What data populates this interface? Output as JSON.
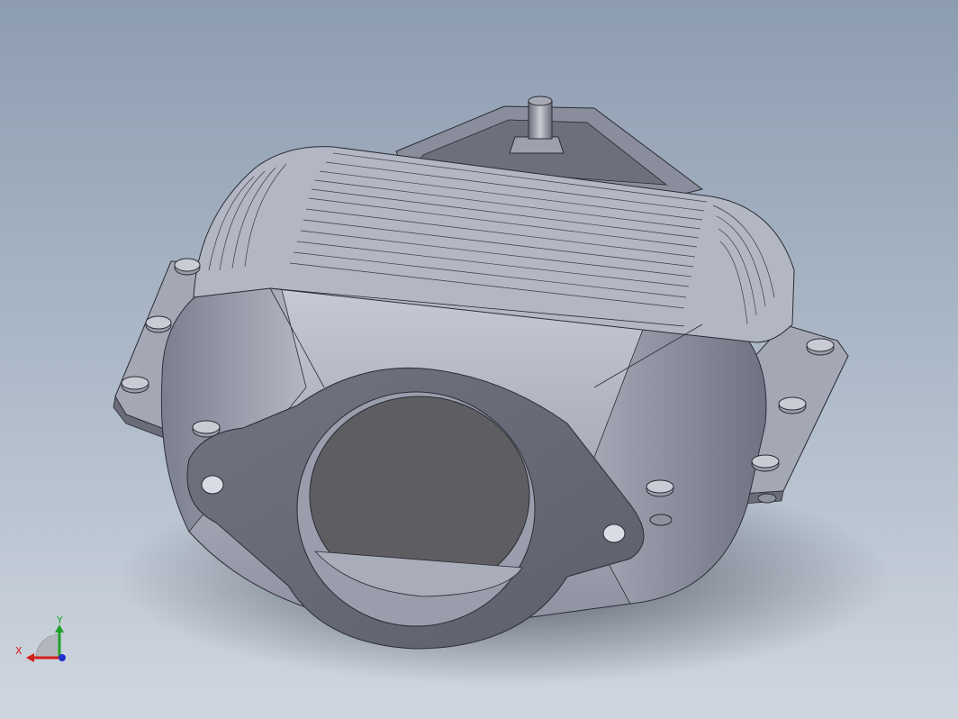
{
  "viewport": {
    "background_top": "#8d9db0",
    "background_bottom": "#cfd6df",
    "part_color": "#b9bcc8"
  },
  "triad": {
    "x_label": "X",
    "y_label": "Y",
    "x_color": "#d21e1e",
    "y_color": "#1fa32a",
    "z_color": "#2030d0"
  }
}
